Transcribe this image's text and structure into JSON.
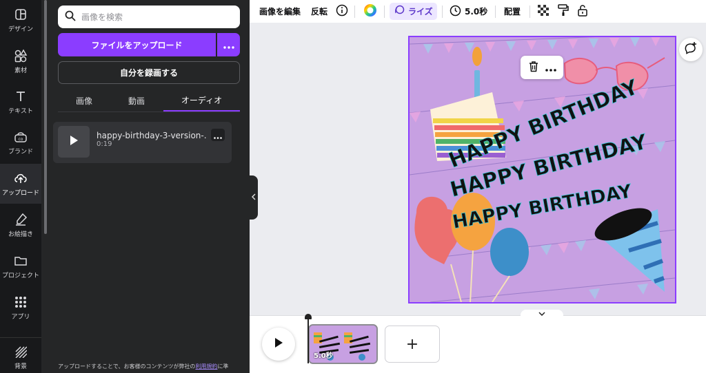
{
  "rail": {
    "items": [
      {
        "label": "デザイン",
        "icon": "design-icon"
      },
      {
        "label": "素材",
        "icon": "elements-icon"
      },
      {
        "label": "テキスト",
        "icon": "text-icon"
      },
      {
        "label": "ブランド",
        "icon": "brand-icon"
      },
      {
        "label": "アップロード",
        "icon": "upload-cloud-icon",
        "active": true
      },
      {
        "label": "お絵描き",
        "icon": "draw-icon"
      },
      {
        "label": "プロジェクト",
        "icon": "folder-icon"
      },
      {
        "label": "アプリ",
        "icon": "apps-grid-icon"
      },
      {
        "label": "背景",
        "icon": "background-icon"
      }
    ]
  },
  "panel": {
    "search_placeholder": "画像を検索",
    "upload_button": "ファイルをアップロード",
    "record_button": "自分を録画する",
    "tabs": [
      "画像",
      "動画",
      "オーディオ"
    ],
    "active_tab": "オーディオ",
    "audio_item": {
      "title": "happy-birthday-3-version-...",
      "duration": "0:19"
    },
    "footer_prefix": "アップロードすることで、お客様のコンテンツが弊社の",
    "footer_link": "利用規約",
    "footer_suffix": "に準"
  },
  "toolbar": {
    "edit_image": "画像を編集",
    "flip": "反転",
    "animation": "ライズ",
    "duration": "5.0秒",
    "position": "配置"
  },
  "canvas": {
    "text_lines": [
      "HAPPY BIRTHDAY",
      "HAPPY BIRTHDAY",
      "HAPPY BIRTHDAY"
    ]
  },
  "timeline": {
    "clip_duration": "5.0秒",
    "add_label": "+"
  },
  "colors": {
    "accent": "#8b3dff",
    "rail_bg": "#18191b",
    "panel_bg": "#252627",
    "canvas_bg": "#c9a2e4"
  }
}
